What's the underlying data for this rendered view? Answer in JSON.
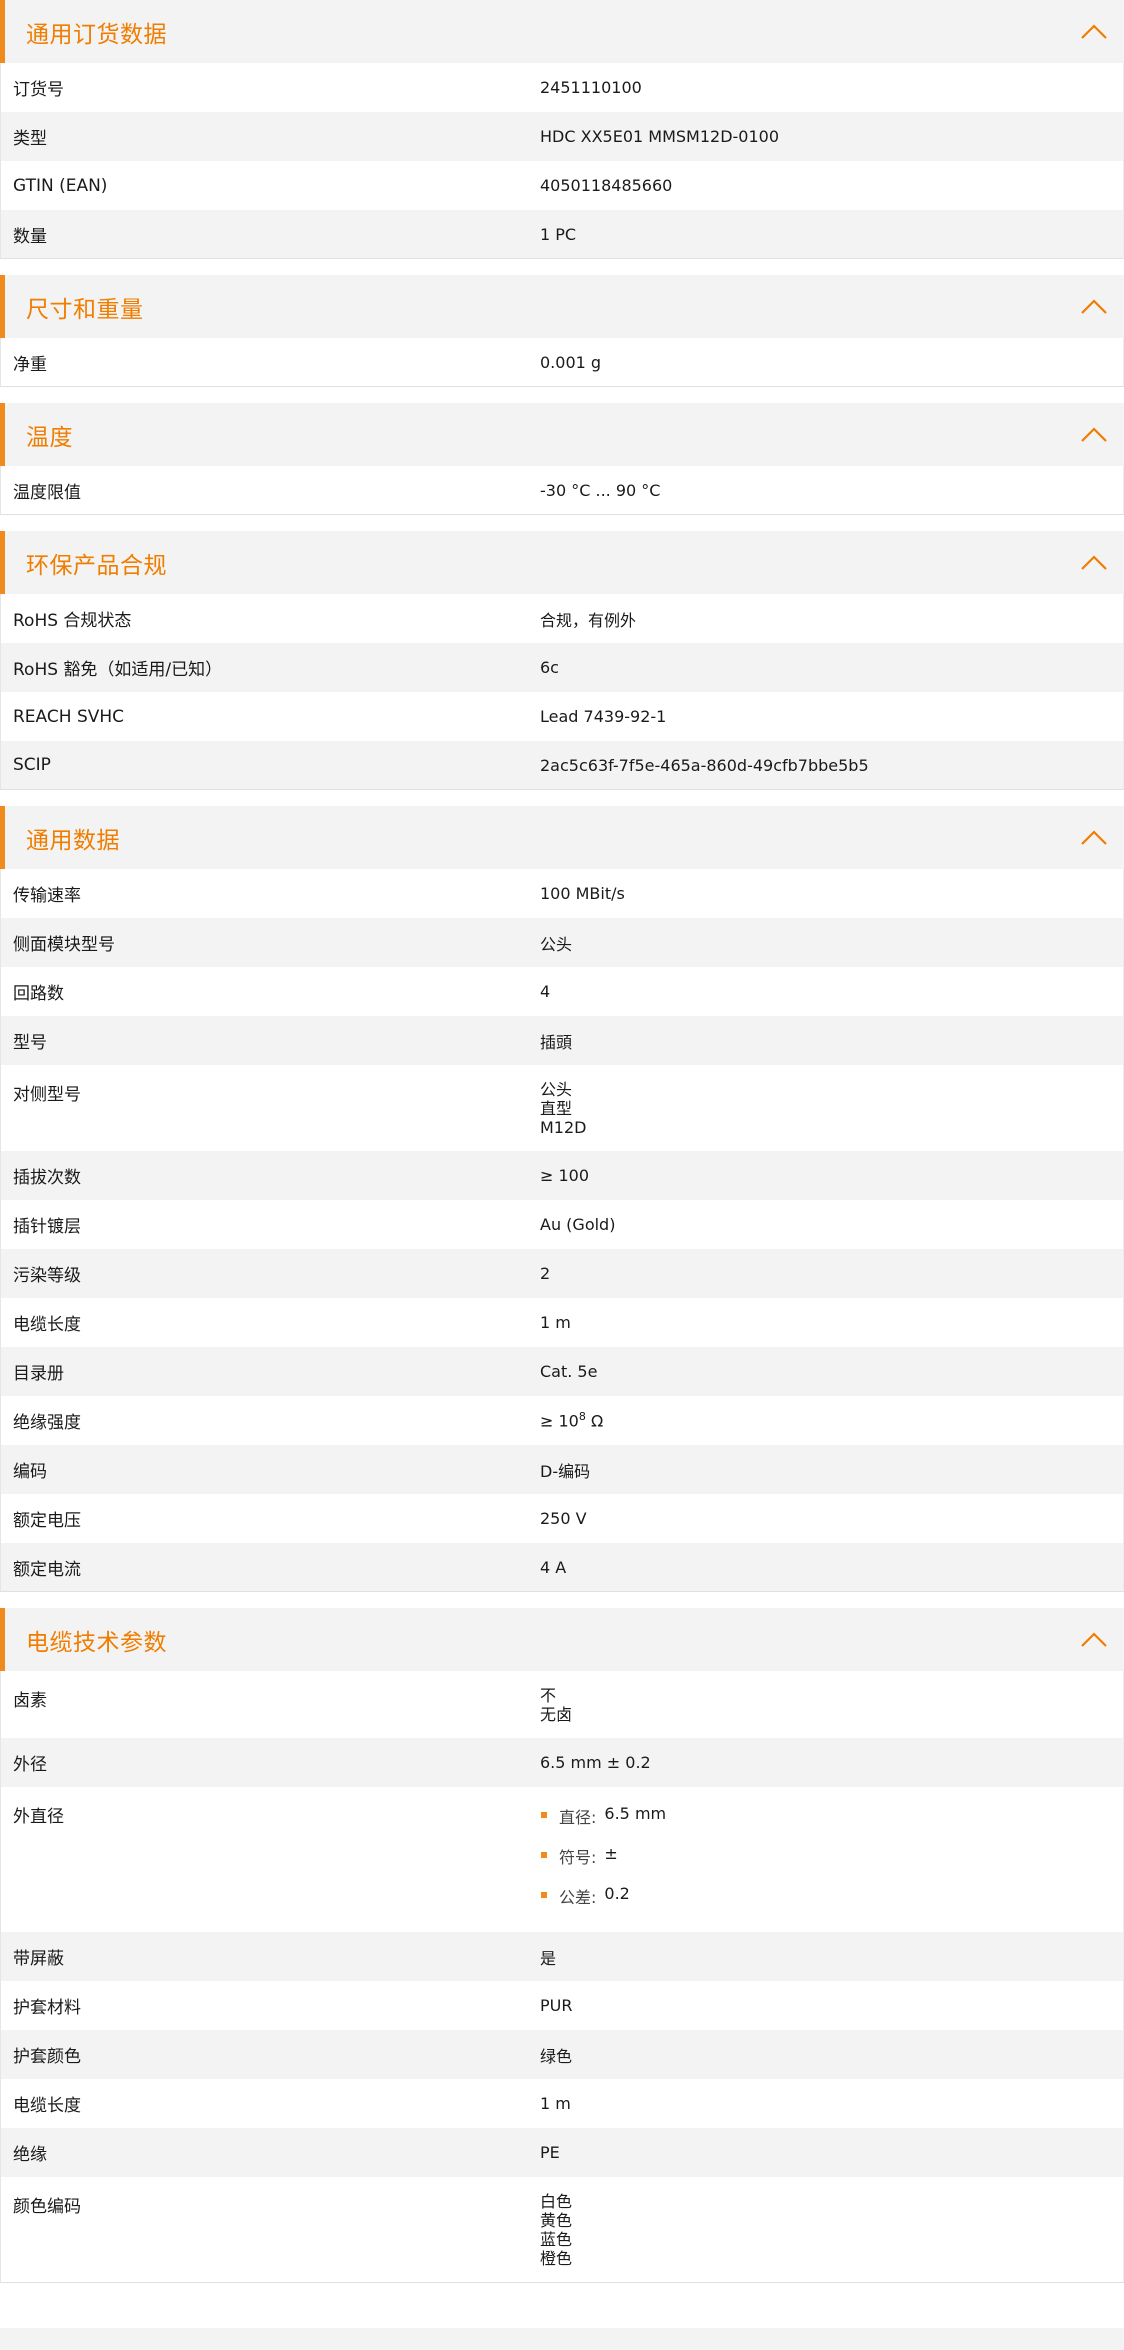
{
  "colors": {
    "accent": "#f07d00",
    "header_bg": "#f3f3f3",
    "row_alt": "#f3f3f3"
  },
  "icons": {
    "section_toggle": "chevron-up-icon",
    "list_bullet": "orange-square-bullet"
  },
  "sections": [
    {
      "title": "通用订货数据",
      "rows": [
        {
          "k": "订货号",
          "v": "2451110100"
        },
        {
          "k": "类型",
          "v": "HDC XX5E01 MMSM12D-0100"
        },
        {
          "k": "GTIN (EAN)",
          "v": "4050118485660"
        },
        {
          "k": "数量",
          "v": "1  PC"
        }
      ]
    },
    {
      "title": "尺寸和重量",
      "rows": [
        {
          "k": "净重",
          "v": "0.001  g"
        }
      ]
    },
    {
      "title": "温度",
      "rows": [
        {
          "k": "温度限值",
          "v": "-30 °C ... 90 °C"
        }
      ]
    },
    {
      "title": "环保产品合规",
      "rows": [
        {
          "k": "RoHS 合规状态",
          "v": "合规，有例外"
        },
        {
          "k": "RoHS 豁免（如适用/已知）",
          "v": "6c"
        },
        {
          "k": "REACH SVHC",
          "v": "Lead 7439-92-1"
        },
        {
          "k": "SCIP",
          "v": "2ac5c63f-7f5e-465a-860d-49cfb7bbe5b5"
        }
      ]
    },
    {
      "title": "通用数据",
      "rows": [
        {
          "k": "传输速率",
          "v": "100 MBit/s"
        },
        {
          "k": "侧面模块型号",
          "v": "公头"
        },
        {
          "k": "回路数",
          "v": "4"
        },
        {
          "k": "型号",
          "v": "插頭"
        },
        {
          "k": "对侧型号",
          "lines": [
            "公头",
            "直型",
            "M12D"
          ]
        },
        {
          "k": "插拔次数",
          "v": "≥ 100"
        },
        {
          "k": "插针镀层",
          "v": "Au (Gold)"
        },
        {
          "k": "污染等级",
          "v": "2"
        },
        {
          "k": "电缆长度",
          "v": "1  m"
        },
        {
          "k": "目录册",
          "v": "Cat. 5e"
        },
        {
          "k": "绝缘强度",
          "v_pre": "≥ 10",
          "v_sup": "8",
          "v_post": " Ω"
        },
        {
          "k": "编码",
          "v": "D-编码"
        },
        {
          "k": "额定电压",
          "v": "250  V"
        },
        {
          "k": "额定电流",
          "v": "4  A"
        }
      ]
    },
    {
      "title": "电缆技术参数",
      "rows": [
        {
          "k": "卤素",
          "lines": [
            "不",
            "无卤"
          ]
        },
        {
          "k": "外径",
          "v": "6.5 mm ± 0.2"
        },
        {
          "k": "外直径",
          "bullets": [
            {
              "label": "直径:",
              "value": "6.5 mm"
            },
            {
              "label": "符号:",
              "value": "±"
            },
            {
              "label": "公差:",
              "value": "0.2"
            }
          ]
        },
        {
          "k": "带屏蔽",
          "v": "是"
        },
        {
          "k": "护套材料",
          "v": "PUR"
        },
        {
          "k": "护套颜色",
          "v": "绿色"
        },
        {
          "k": "电缆长度",
          "v": "1  m"
        },
        {
          "k": "绝缘",
          "v": "PE"
        },
        {
          "k": "颜色编码",
          "lines": [
            "白色",
            "黄色",
            "蓝色",
            "橙色"
          ]
        }
      ]
    }
  ]
}
